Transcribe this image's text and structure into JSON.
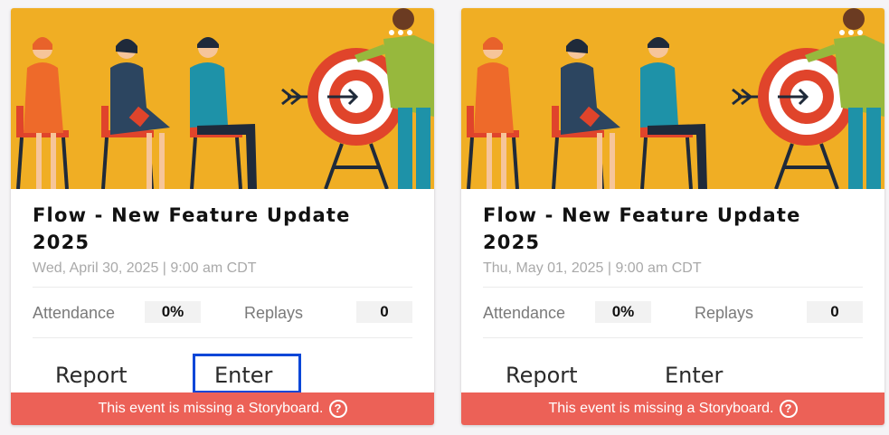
{
  "colors": {
    "banner_background": "#f0ae24",
    "warning_background": "#ec6157",
    "selection_outline": "#0a47d8"
  },
  "events": [
    {
      "title": "Flow - New Feature Update 2025",
      "datetime": "Wed, April 30, 2025 | 9:00 am CDT",
      "attendance_label": "Attendance",
      "attendance_value": "0%",
      "replays_label": "Replays",
      "replays_value": "0",
      "report_label": "Report",
      "enter_label": "Enter",
      "warning": "This event is missing a Storyboard.",
      "help_icon": "question-circle-icon",
      "menu_icon": "more-dots-icon",
      "enter_selected": true
    },
    {
      "title": "Flow - New Feature Update 2025",
      "datetime": "Thu, May 01, 2025 | 9:00 am CDT",
      "attendance_label": "Attendance",
      "attendance_value": "0%",
      "replays_label": "Replays",
      "replays_value": "0",
      "report_label": "Report",
      "enter_label": "Enter",
      "warning": "This event is missing a Storyboard.",
      "help_icon": "question-circle-icon",
      "menu_icon": "more-dots-icon",
      "enter_selected": false
    }
  ]
}
